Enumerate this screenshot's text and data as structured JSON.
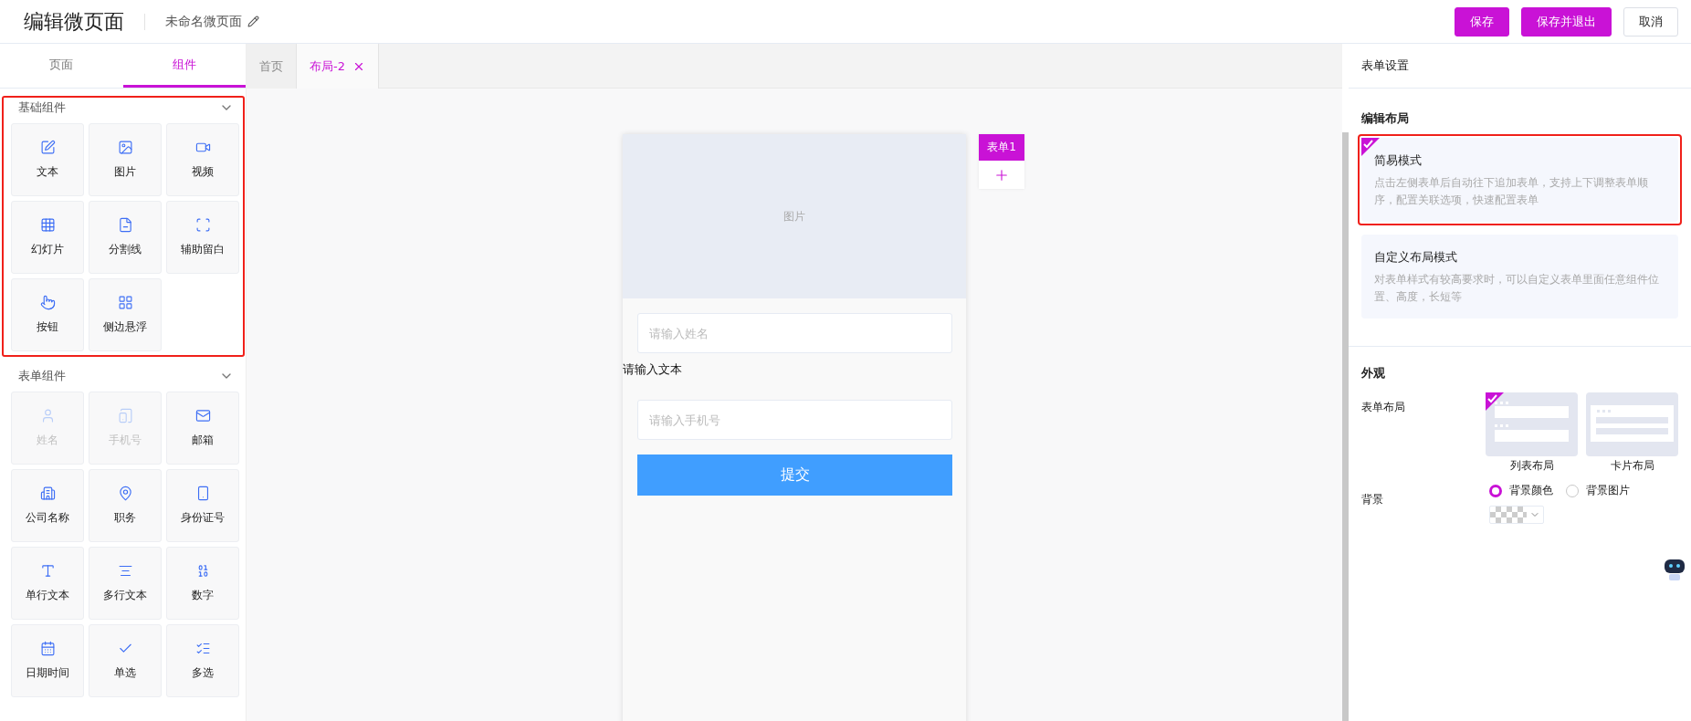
{
  "header": {
    "title": "编辑微页面",
    "page_name": "未命名微页面",
    "buttons": [
      {
        "label": "保存",
        "kind": "primary"
      },
      {
        "label": "保存并退出",
        "kind": "primary"
      },
      {
        "label": "取消",
        "kind": "default"
      }
    ]
  },
  "sidebar": {
    "tabs": [
      {
        "label": "页面",
        "selected": false
      },
      {
        "label": "组件",
        "selected": true
      }
    ],
    "groups": [
      {
        "title": "基础组件",
        "highlighted": true,
        "items": [
          {
            "label": "文本",
            "disabled": false
          },
          {
            "label": "图片",
            "disabled": false
          },
          {
            "label": "视频",
            "disabled": false
          },
          {
            "label": "幻灯片",
            "disabled": false
          },
          {
            "label": "分割线",
            "disabled": false
          },
          {
            "label": "辅助留白",
            "disabled": false
          },
          {
            "label": "按钮",
            "disabled": false
          },
          {
            "label": "侧边悬浮",
            "disabled": false
          }
        ]
      },
      {
        "title": "表单组件",
        "highlighted": false,
        "items": [
          {
            "label": "姓名",
            "disabled": true
          },
          {
            "label": "手机号",
            "disabled": true
          },
          {
            "label": "邮箱",
            "disabled": false
          },
          {
            "label": "公司名称",
            "disabled": false
          },
          {
            "label": "职务",
            "disabled": false
          },
          {
            "label": "身份证号",
            "disabled": false
          },
          {
            "label": "单行文本",
            "disabled": false
          },
          {
            "label": "多行文本",
            "disabled": false
          },
          {
            "label": "数字",
            "disabled": false
          },
          {
            "label": "日期时间",
            "disabled": false
          },
          {
            "label": "单选",
            "disabled": false
          },
          {
            "label": "多选",
            "disabled": false
          }
        ]
      }
    ]
  },
  "editor_tabs": [
    {
      "label": "首页",
      "selected": false,
      "closable": false
    },
    {
      "label": "布局-2",
      "selected": true,
      "closable": true
    }
  ],
  "preview": {
    "image_label": "图片",
    "fields": [
      {
        "kind": "input",
        "placeholder": "请输入姓名"
      },
      {
        "kind": "text",
        "text": "请输入文本"
      },
      {
        "kind": "input",
        "placeholder": "请输入手机号"
      }
    ],
    "submit": "提交"
  },
  "form_tabs": [
    {
      "label": "表单1",
      "selected": true
    }
  ],
  "settings": {
    "title": "表单设置",
    "layout_section": {
      "title": "编辑布局",
      "modes": [
        {
          "title": "简易模式",
          "description": "点击左侧表单后自动往下追加表单，支持上下调整表单顺序，配置关联选项，快速配置表单",
          "selected": true,
          "highlighted": true
        },
        {
          "title": "自定义布局模式",
          "description": "对表单样式有较高要求时，可以自定义表单里面任意组件位置、高度，长短等",
          "selected": false,
          "highlighted": false
        }
      ]
    },
    "appearance": {
      "title": "外观",
      "layout_label": "表单布局",
      "layouts": [
        {
          "label": "列表布局",
          "kind": "list",
          "selected": true
        },
        {
          "label": "卡片布局",
          "kind": "card",
          "selected": false
        }
      ],
      "background_label": "背景",
      "background_options": [
        {
          "label": "背景颜色",
          "selected": true
        },
        {
          "label": "背景图片",
          "selected": false
        }
      ]
    }
  }
}
